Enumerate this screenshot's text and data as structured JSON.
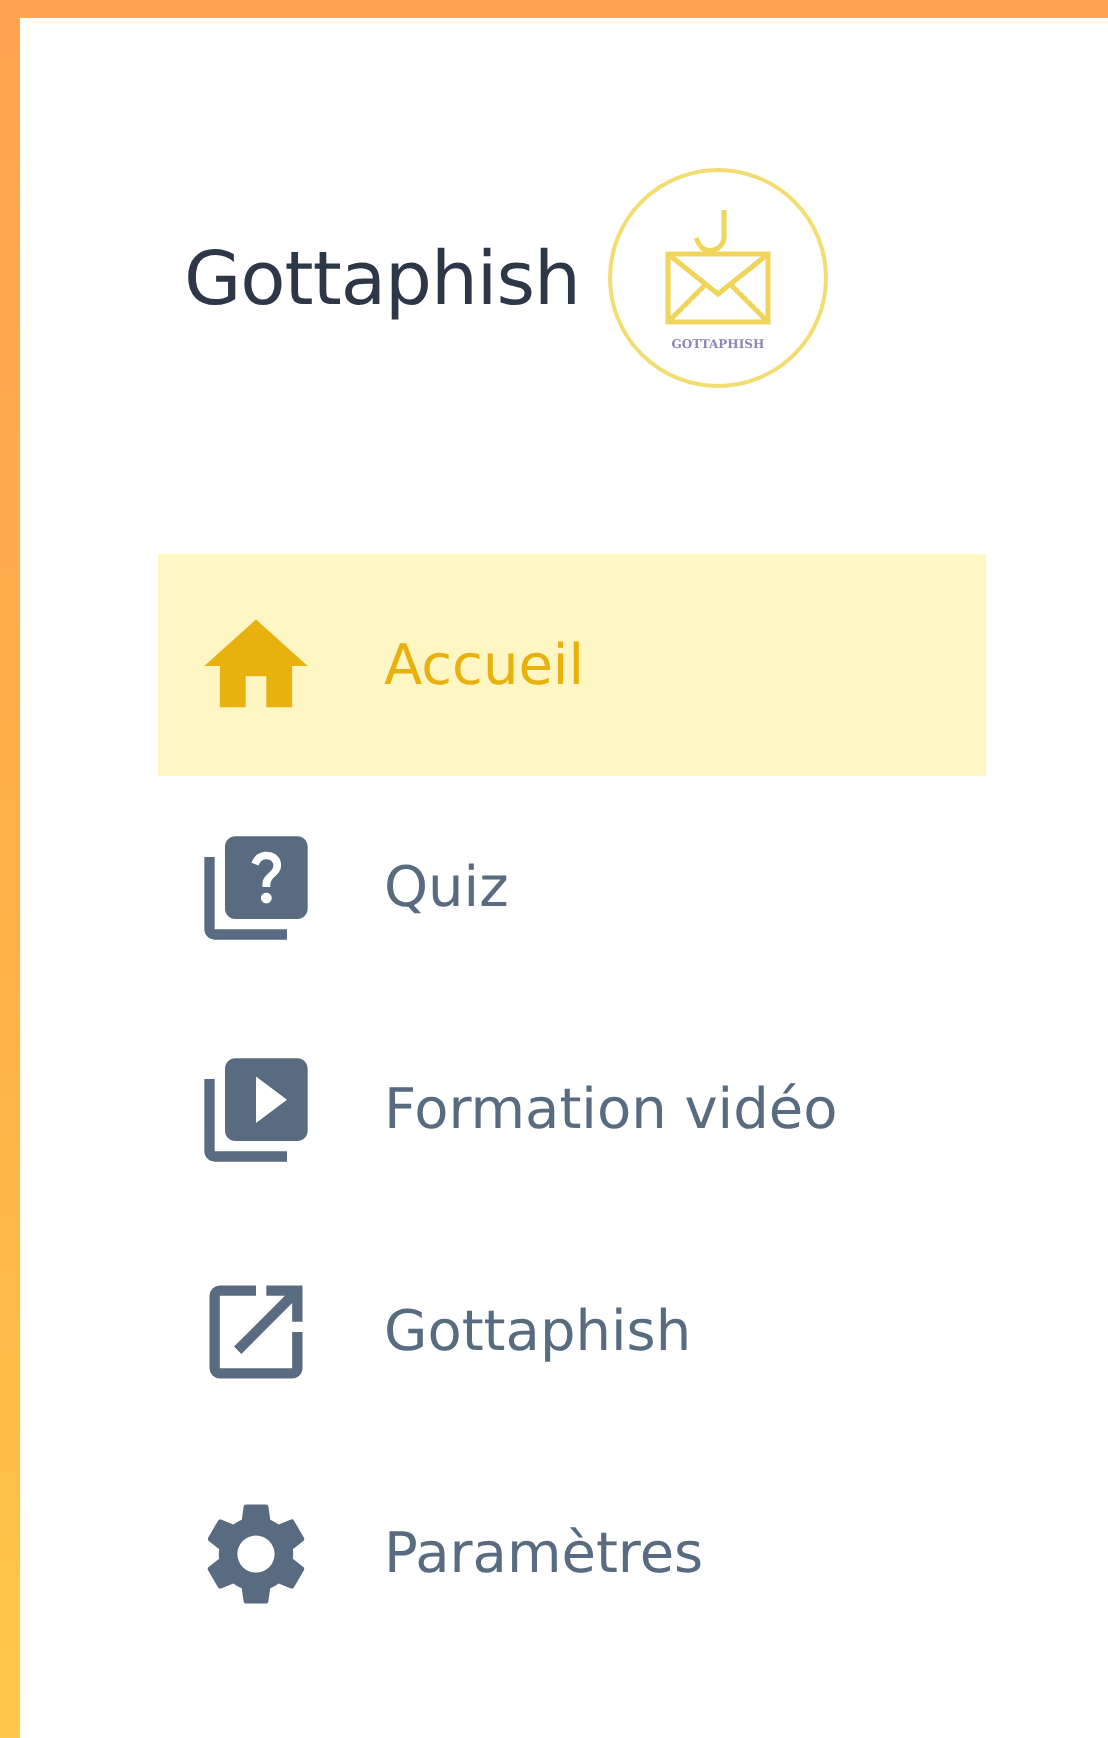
{
  "app_name": "Gottaphish",
  "logo": {
    "text": "GOTTAPHISH"
  },
  "nav_items": [
    {
      "label": "Accueil",
      "selected": true
    },
    {
      "label": "Quiz",
      "selected": false
    },
    {
      "label": "Formation vidéo",
      "selected": false
    },
    {
      "label": "Gottaphish",
      "selected": false
    },
    {
      "label": "Paramètres",
      "selected": false
    }
  ]
}
